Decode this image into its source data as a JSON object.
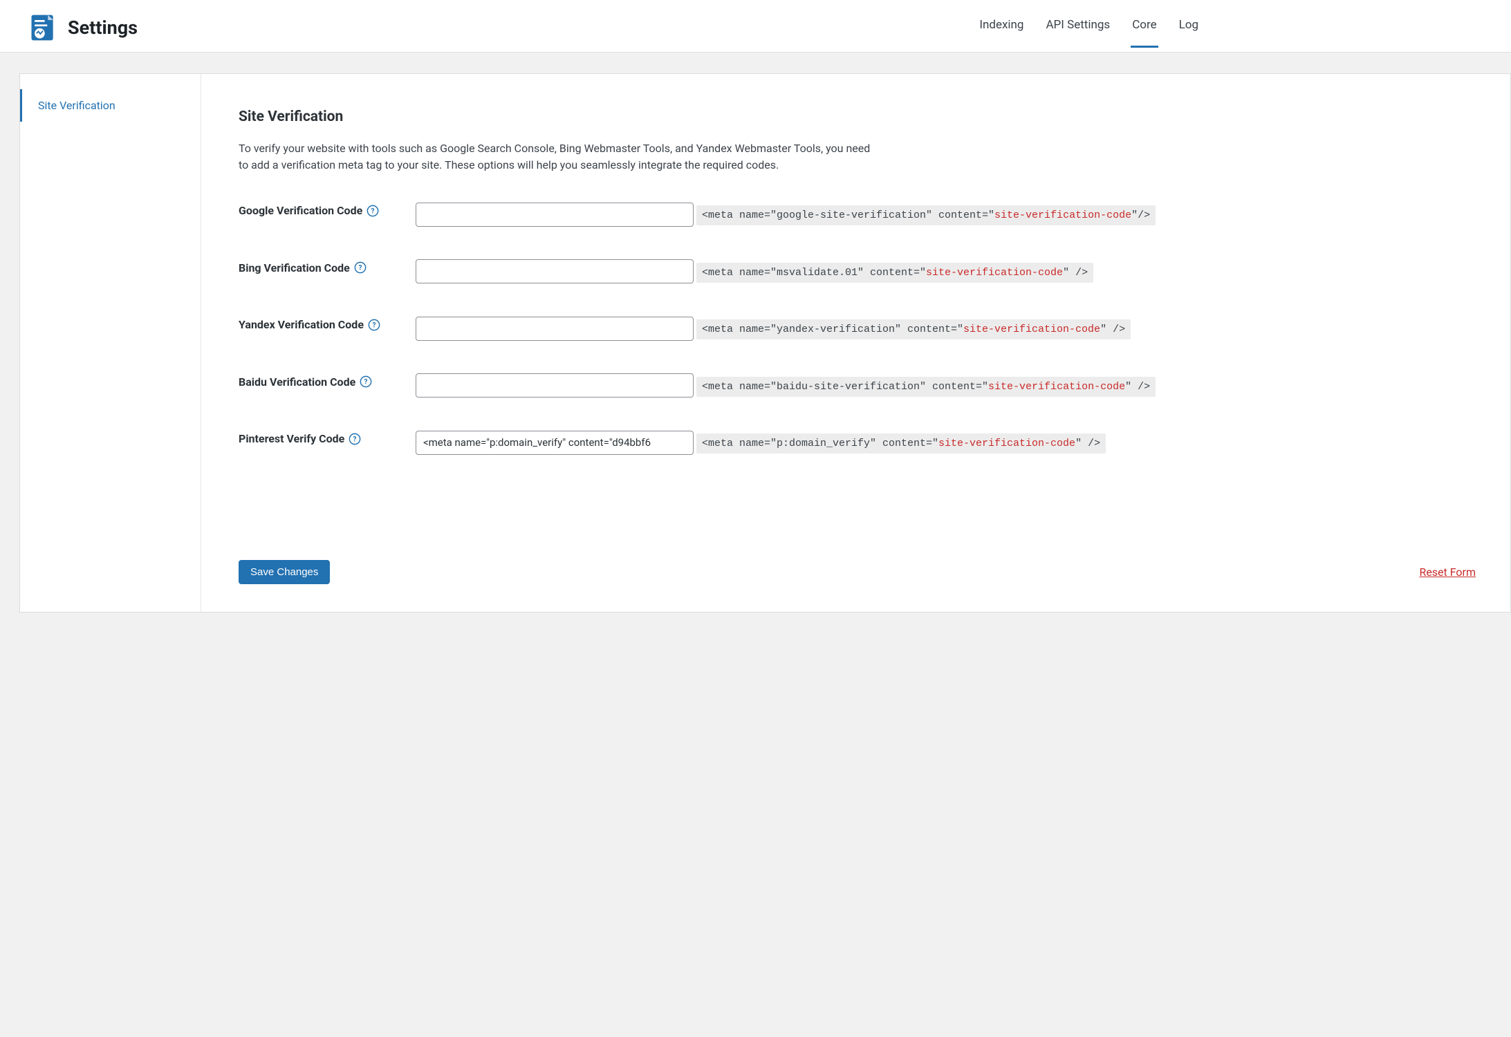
{
  "header": {
    "title": "Settings",
    "tabs": [
      {
        "label": "Indexing",
        "active": false
      },
      {
        "label": "API Settings",
        "active": false
      },
      {
        "label": "Core",
        "active": true
      },
      {
        "label": "Log",
        "active": false
      }
    ]
  },
  "sidebar": {
    "items": [
      {
        "label": "Site Verification",
        "active": true
      }
    ]
  },
  "section": {
    "title": "Site Verification",
    "description": "To verify your website with tools such as Google Search Console, Bing Webmaster Tools, and Yandex Webmaster Tools, you need to add a verification meta tag to your site. These options will help you seamlessly integrate the required codes."
  },
  "fields": {
    "google": {
      "label": "Google Verification Code",
      "value": "",
      "hint_prefix": "<meta name=\"google-site-verification\" content=\"",
      "hint_code": "site-verification-code",
      "hint_suffix": "\"/>"
    },
    "bing": {
      "label": "Bing Verification Code",
      "value": "",
      "hint_prefix": "<meta name=\"msvalidate.01\" content=\"",
      "hint_code": "site-verification-code",
      "hint_suffix": "\" />"
    },
    "yandex": {
      "label": "Yandex Verification Code",
      "value": "",
      "hint_prefix": "<meta name=\"yandex-verification\" content=\"",
      "hint_code": "site-verification-code",
      "hint_suffix": "\" />"
    },
    "baidu": {
      "label": "Baidu Verification Code",
      "value": "",
      "hint_prefix": "<meta name=\"baidu-site-verification\" content=\"",
      "hint_code": "site-verification-code",
      "hint_suffix": "\" />"
    },
    "pinterest": {
      "label": "Pinterest Verify Code",
      "value": "<meta name=\"p:domain_verify\" content=\"d94bbf6",
      "hint_prefix": "<meta name=\"p:domain_verify\" content=\"",
      "hint_code": "site-verification-code",
      "hint_suffix": "\" />"
    }
  },
  "footer": {
    "save_label": "Save Changes",
    "reset_label": "Reset Form"
  }
}
